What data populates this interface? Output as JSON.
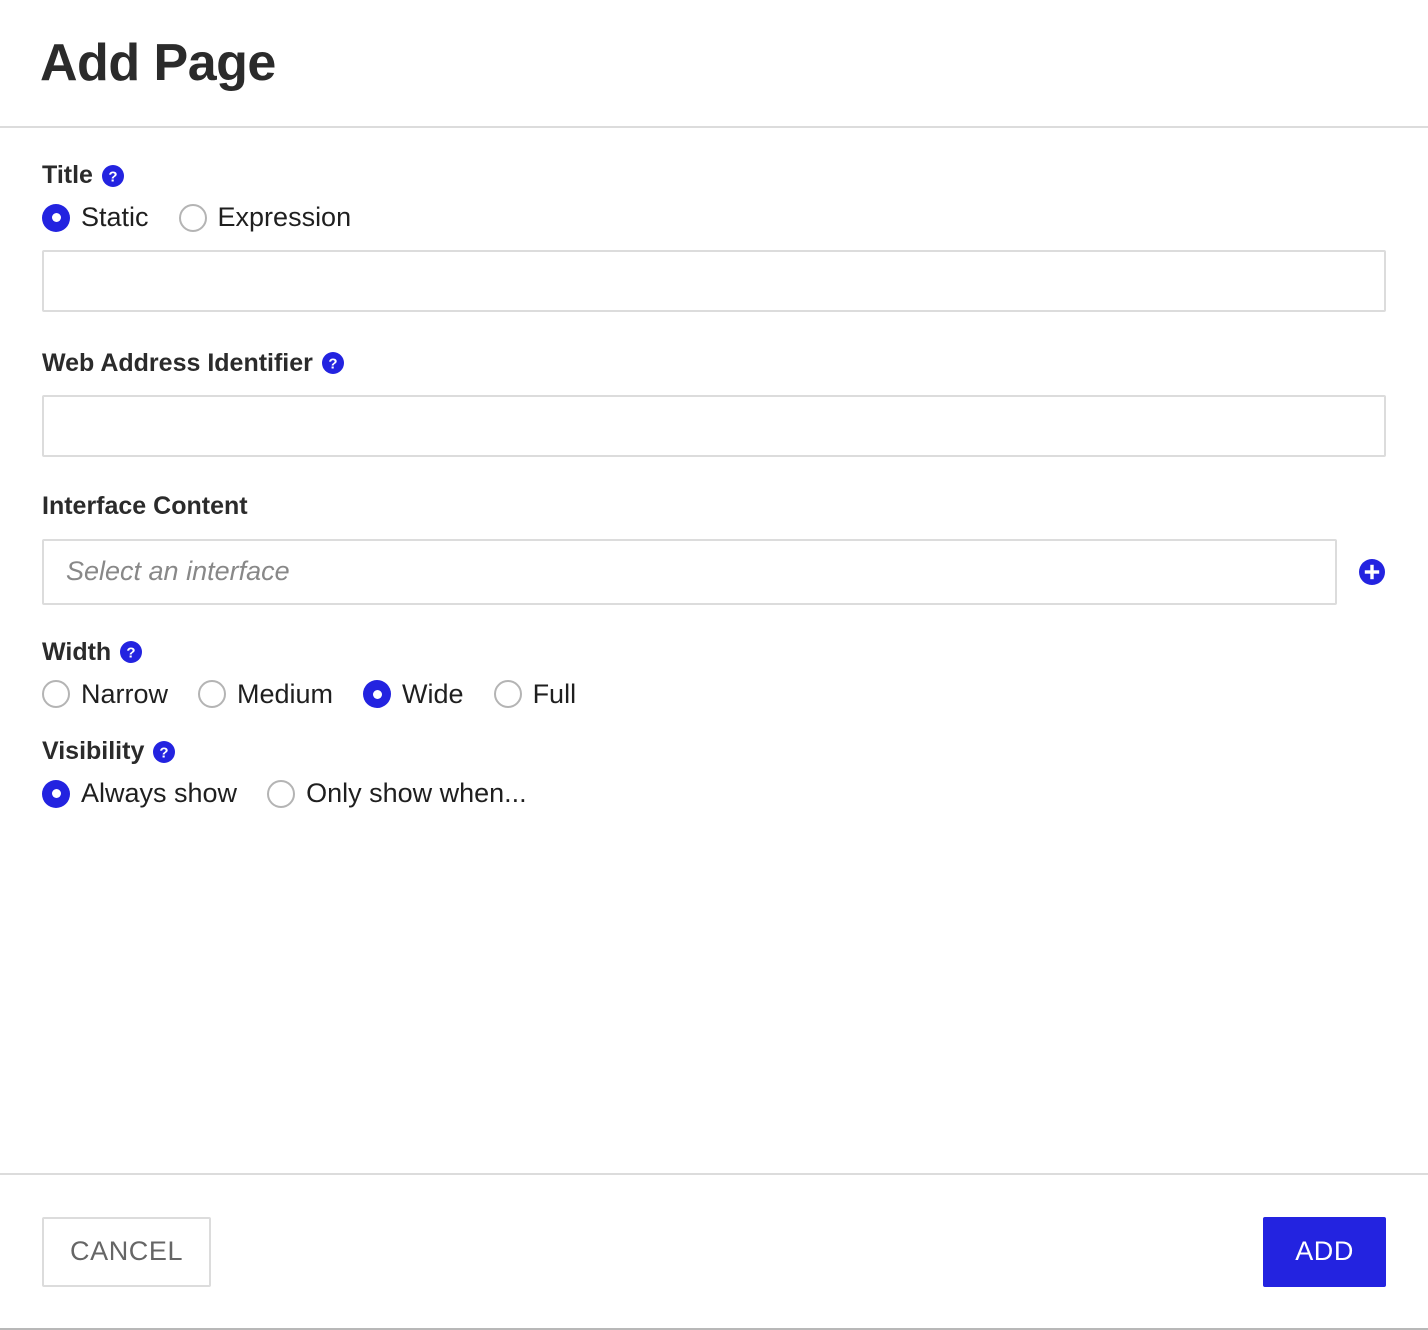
{
  "dialog": {
    "title": "Add Page"
  },
  "fields": {
    "title": {
      "label": "Title",
      "help_icon": "help-circle-icon",
      "options": [
        {
          "label": "Static",
          "selected": true
        },
        {
          "label": "Expression",
          "selected": false
        }
      ],
      "value": "",
      "placeholder": ""
    },
    "web_address_identifier": {
      "label": "Web Address Identifier",
      "help_icon": "help-circle-icon",
      "value": "",
      "placeholder": ""
    },
    "interface_content": {
      "label": "Interface Content",
      "value": "",
      "placeholder": "Select an interface",
      "add_icon": "add-circle-icon"
    },
    "width": {
      "label": "Width",
      "help_icon": "help-circle-icon",
      "options": [
        {
          "label": "Narrow",
          "selected": false
        },
        {
          "label": "Medium",
          "selected": false
        },
        {
          "label": "Wide",
          "selected": true
        },
        {
          "label": "Full",
          "selected": false
        }
      ]
    },
    "visibility": {
      "label": "Visibility",
      "help_icon": "help-circle-icon",
      "options": [
        {
          "label": "Always show",
          "selected": true
        },
        {
          "label": "Only show when...",
          "selected": false
        }
      ]
    }
  },
  "footer": {
    "cancel_label": "CANCEL",
    "add_label": "ADD"
  },
  "colors": {
    "accent": "#2323e0",
    "text": "#1f1f1f",
    "label": "#2b2b2b",
    "border": "#dcdcdc",
    "muted": "#888888"
  }
}
